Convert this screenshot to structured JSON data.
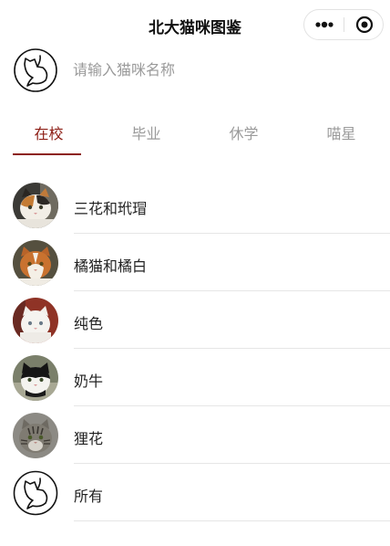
{
  "header": {
    "title": "北大猫咪图鉴"
  },
  "search": {
    "placeholder": "请输入猫咪名称",
    "value": ""
  },
  "tabs": [
    {
      "label": "在校",
      "active": true
    },
    {
      "label": "毕业",
      "active": false
    },
    {
      "label": "休学",
      "active": false
    },
    {
      "label": "喵星",
      "active": false
    }
  ],
  "categories": [
    {
      "label": "三花和玳瑁",
      "avatar": "calico-cat-photo"
    },
    {
      "label": "橘猫和橘白",
      "avatar": "orange-white-cat-photo"
    },
    {
      "label": "纯色",
      "avatar": "white-cat-photo"
    },
    {
      "label": "奶牛",
      "avatar": "black-white-cat-photo"
    },
    {
      "label": "狸花",
      "avatar": "tabby-cat-photo"
    },
    {
      "label": "所有",
      "avatar": "cat-logo-icon"
    }
  ],
  "colors": {
    "accent": "#8c1c13",
    "inactive_tab": "#9a9a9a",
    "placeholder": "#9a9a9a"
  }
}
